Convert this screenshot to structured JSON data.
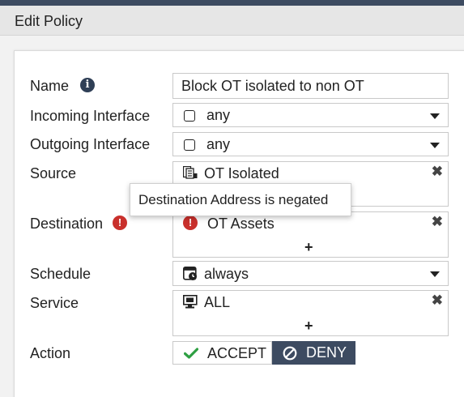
{
  "window": {
    "title": "Edit Policy"
  },
  "form": {
    "name": {
      "label": "Name",
      "value": "Block OT isolated to non OT"
    },
    "incoming": {
      "label": "Incoming Interface",
      "value": "any"
    },
    "outgoing": {
      "label": "Outgoing Interface",
      "value": "any"
    },
    "source": {
      "label": "Source",
      "entries": [
        "OT Isolated"
      ]
    },
    "destination": {
      "label": "Destination",
      "entries": [
        "OT Assets"
      ]
    },
    "schedule": {
      "label": "Schedule",
      "value": "always"
    },
    "service": {
      "label": "Service",
      "entries": [
        "ALL"
      ]
    },
    "action": {
      "label": "Action",
      "accept_label": "ACCEPT",
      "deny_label": "DENY",
      "selected": "DENY"
    }
  },
  "tooltip": {
    "text": "Destination Address is negated"
  },
  "glyphs": {
    "remove": "✖",
    "add": "+",
    "info": "i",
    "warning": "!"
  },
  "colors": {
    "header": "#3d4b61",
    "accept_check": "#2fa043",
    "error": "#c9302c"
  }
}
